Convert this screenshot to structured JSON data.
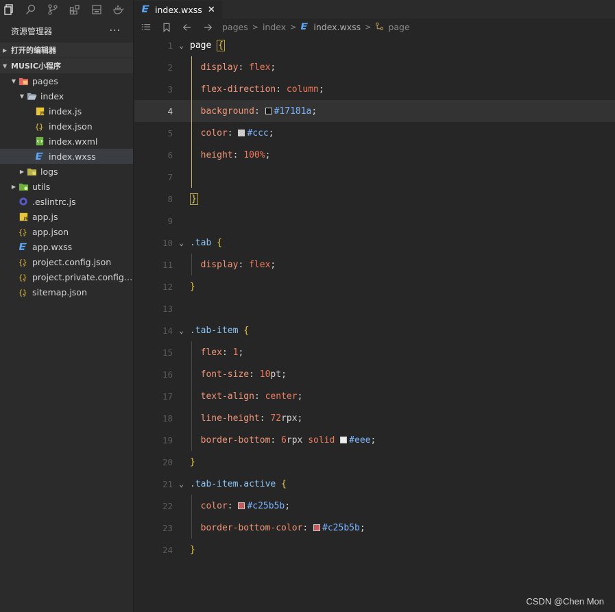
{
  "explorer": {
    "title": "资源管理器",
    "more": "···",
    "open_editors": "打开的编辑器",
    "project": "MUSIC小程序"
  },
  "tree": [
    {
      "label": "pages",
      "depth": 1,
      "twisty": "open",
      "icon": "pages-folder-icon"
    },
    {
      "label": "index",
      "depth": 2,
      "twisty": "open",
      "icon": "folder-open-icon"
    },
    {
      "label": "index.js",
      "depth": 3,
      "icon": "js-file-icon"
    },
    {
      "label": "index.json",
      "depth": 3,
      "icon": "json-file-icon"
    },
    {
      "label": "index.wxml",
      "depth": 3,
      "icon": "wxml-file-icon"
    },
    {
      "label": "index.wxss",
      "depth": 3,
      "icon": "wxss-file-icon",
      "selected": true
    },
    {
      "label": "logs",
      "depth": 2,
      "twisty": "closed",
      "icon": "folder-icon"
    },
    {
      "label": "utils",
      "depth": 1,
      "twisty": "closed",
      "icon": "utils-folder-icon"
    },
    {
      "label": ".eslintrc.js",
      "depth": 1,
      "icon": "eslint-file-icon"
    },
    {
      "label": "app.js",
      "depth": 1,
      "icon": "js-file-icon"
    },
    {
      "label": "app.json",
      "depth": 1,
      "icon": "json-file-icon"
    },
    {
      "label": "app.wxss",
      "depth": 1,
      "icon": "wxss-file-icon"
    },
    {
      "label": "project.config.json",
      "depth": 1,
      "icon": "json-file-icon"
    },
    {
      "label": "project.private.config.js...",
      "depth": 1,
      "icon": "json-file-icon"
    },
    {
      "label": "sitemap.json",
      "depth": 1,
      "icon": "json-file-icon"
    }
  ],
  "tab": {
    "label": "index.wxss",
    "close": "✕"
  },
  "breadcrumbs": [
    "pages",
    "index",
    "index.wxss",
    "page"
  ],
  "code": {
    "current_line": 4,
    "lines": [
      [
        [
          "sel-tag",
          "page"
        ],
        [
          "punc",
          " "
        ],
        [
          "brace",
          "{"
        ]
      ],
      [
        [
          "indent",
          ""
        ],
        [
          "prop",
          "display"
        ],
        [
          "punc",
          ": "
        ],
        [
          "val",
          "flex"
        ],
        [
          "punc",
          ";"
        ]
      ],
      [
        [
          "indent",
          ""
        ],
        [
          "prop",
          "flex-direction"
        ],
        [
          "punc",
          ": "
        ],
        [
          "val",
          "column"
        ],
        [
          "punc",
          ";"
        ]
      ],
      [
        [
          "indent",
          ""
        ],
        [
          "prop",
          "background"
        ],
        [
          "punc",
          ": "
        ],
        [
          "swatch",
          "#17181a"
        ],
        [
          "hex",
          "#17181a"
        ],
        [
          "punc",
          ";"
        ]
      ],
      [
        [
          "indent",
          ""
        ],
        [
          "prop",
          "color"
        ],
        [
          "punc",
          ": "
        ],
        [
          "swatch",
          "#cccccc"
        ],
        [
          "hex",
          "#ccc"
        ],
        [
          "punc",
          ";"
        ]
      ],
      [
        [
          "indent",
          ""
        ],
        [
          "prop",
          "height"
        ],
        [
          "punc",
          ": "
        ],
        [
          "num",
          "100%"
        ],
        [
          "punc",
          ";"
        ]
      ],
      [],
      [
        [
          "brace",
          "}"
        ]
      ],
      [],
      [
        [
          "cls",
          ".tab"
        ],
        [
          "punc",
          " "
        ],
        [
          "brace",
          "{"
        ]
      ],
      [
        [
          "indent",
          ""
        ],
        [
          "prop",
          "display"
        ],
        [
          "punc",
          ": "
        ],
        [
          "val",
          "flex"
        ],
        [
          "punc",
          ";"
        ]
      ],
      [
        [
          "brace",
          "}"
        ]
      ],
      [],
      [
        [
          "cls",
          ".tab-item"
        ],
        [
          "punc",
          " "
        ],
        [
          "brace",
          "{"
        ]
      ],
      [
        [
          "indent",
          ""
        ],
        [
          "prop",
          "flex"
        ],
        [
          "punc",
          ": "
        ],
        [
          "num",
          "1"
        ],
        [
          "punc",
          ";"
        ]
      ],
      [
        [
          "indent",
          ""
        ],
        [
          "prop",
          "font-size"
        ],
        [
          "punc",
          ": "
        ],
        [
          "num",
          "10"
        ],
        [
          "unit",
          "pt"
        ],
        [
          "punc",
          ";"
        ]
      ],
      [
        [
          "indent",
          ""
        ],
        [
          "prop",
          "text-align"
        ],
        [
          "punc",
          ": "
        ],
        [
          "val",
          "center"
        ],
        [
          "punc",
          ";"
        ]
      ],
      [
        [
          "indent",
          ""
        ],
        [
          "prop",
          "line-height"
        ],
        [
          "punc",
          ": "
        ],
        [
          "num",
          "72"
        ],
        [
          "unit",
          "rpx"
        ],
        [
          "punc",
          ";"
        ]
      ],
      [
        [
          "indent",
          ""
        ],
        [
          "prop",
          "border-bottom"
        ],
        [
          "punc",
          ": "
        ],
        [
          "num",
          "6"
        ],
        [
          "unit",
          "rpx"
        ],
        [
          "punc",
          " "
        ],
        [
          "val",
          "solid"
        ],
        [
          "punc",
          " "
        ],
        [
          "swatch",
          "#eeeeee"
        ],
        [
          "hex",
          "#eee"
        ],
        [
          "punc",
          ";"
        ]
      ],
      [
        [
          "brace",
          "}"
        ]
      ],
      [
        [
          "cls",
          ".tab-item.active"
        ],
        [
          "punc",
          " "
        ],
        [
          "brace",
          "{"
        ]
      ],
      [
        [
          "indent",
          ""
        ],
        [
          "prop",
          "color"
        ],
        [
          "punc",
          ": "
        ],
        [
          "swatch",
          "#c25b5b"
        ],
        [
          "hex",
          "#c25b5b"
        ],
        [
          "punc",
          ";"
        ]
      ],
      [
        [
          "indent",
          ""
        ],
        [
          "prop",
          "border-bottom-color"
        ],
        [
          "punc",
          ": "
        ],
        [
          "swatch",
          "#c25b5b"
        ],
        [
          "hex",
          "#c25b5b"
        ],
        [
          "punc",
          ";"
        ]
      ],
      [
        [
          "brace",
          "}"
        ]
      ]
    ],
    "fold_lines": [
      1,
      10,
      14,
      21
    ]
  },
  "watermark": "CSDN @Chen Mon"
}
